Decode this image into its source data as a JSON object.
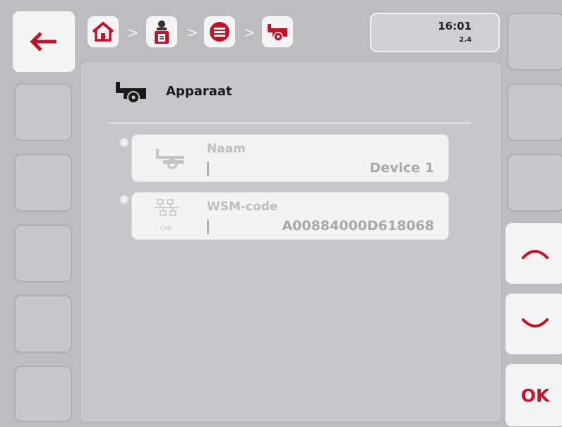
{
  "status": {
    "time": "16:01",
    "version": "2.4"
  },
  "header": {
    "breadcrumb": [
      "home-icon",
      "operator-icon",
      "list-icon",
      "device-icon"
    ],
    "separator": ">"
  },
  "page": {
    "title": "Apparaat",
    "title_icon": "device-icon"
  },
  "fields": [
    {
      "index": "1",
      "label": "Naam",
      "value": "Device 1",
      "icon": "device-icon"
    },
    {
      "index": "2",
      "label": "WSM-code",
      "value": "A00884000D618068",
      "icon": "can-network-icon",
      "icon_text": "CAN"
    }
  ],
  "right_buttons": {
    "ok_label": "OK"
  },
  "colors": {
    "accent": "#c0122b",
    "panel": "#c7c7cb",
    "button": "#f4f4f5"
  }
}
